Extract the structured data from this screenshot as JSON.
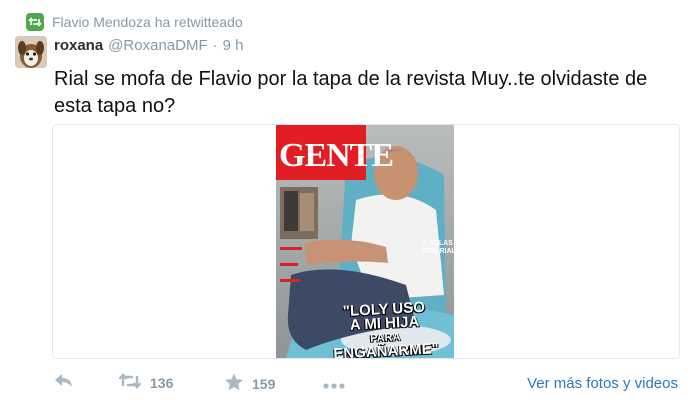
{
  "retweet_context": {
    "text": "Flavio Mendoza ha retwitteado",
    "icon": "retweet-icon"
  },
  "tweet": {
    "name": "roxana",
    "handle": "@RoxanaDMF",
    "separator": "·",
    "time": "9 h",
    "text": "Rial se mofa de Flavio por la tapa de la revista Muy..te olvidaste de esta tapa no?"
  },
  "media": {
    "magazine_logo": "GENTE",
    "side_tag": "A SOLAS CON RIAL",
    "headline_lines": [
      "\"LOLY USO",
      "A MI HIJA",
      "PARA",
      "ENGAÑARME\""
    ]
  },
  "actions": {
    "reply_icon": "reply-icon",
    "retweet_count": "136",
    "favorite_count": "159",
    "more_icon": "more-icon",
    "media_link": "Ver más fotos y videos"
  },
  "colors": {
    "accent": "#2b7bb9",
    "muted": "#8899a6",
    "retweet_green": "#4fa94c",
    "gente_red": "#e21d23"
  }
}
